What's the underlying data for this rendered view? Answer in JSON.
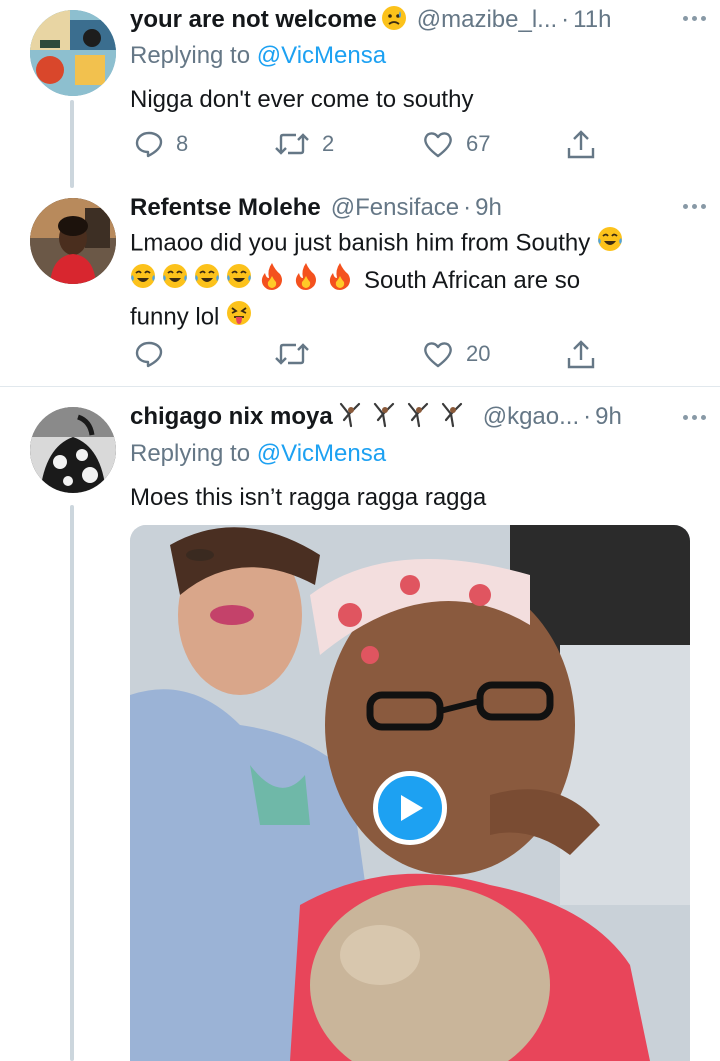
{
  "tweets": [
    {
      "name": "your are not welcome",
      "name_emoji": "worried-face-emoji",
      "handle": "@mazibe_l...",
      "time": "11h",
      "replying_prefix": "Replying to",
      "replying_to": "@VicMensa",
      "text": "Nigga don't ever come to southy",
      "reply_count": "8",
      "retweet_count": "2",
      "like_count": "67"
    },
    {
      "name": "Refentse Molehe",
      "handle": "@Fensiface",
      "time": "9h",
      "text_line1": "Lmaoo did you just banish him from Southy",
      "text_line2": "South African are so",
      "text_line3": "funny lol",
      "emojis": [
        "tears-of-joy-emoji",
        "fire-emoji",
        "squinting-tongue-emoji"
      ],
      "reply_count": "",
      "retweet_count": "",
      "like_count": "20"
    },
    {
      "name": "chigago nix moya",
      "name_emoji": "person-cartwheeling-emoji",
      "handle": "@kgao...",
      "time": "9h",
      "replying_prefix": "Replying to",
      "replying_to": "@VicMensa",
      "text": "Moes this isn’t  ragga ragga ragga",
      "media_type": "video"
    }
  ],
  "colors": {
    "accent": "#1da1f2",
    "secondary_text": "#657786",
    "primary_text": "#14171a",
    "thread_line": "#ccd6dd"
  }
}
